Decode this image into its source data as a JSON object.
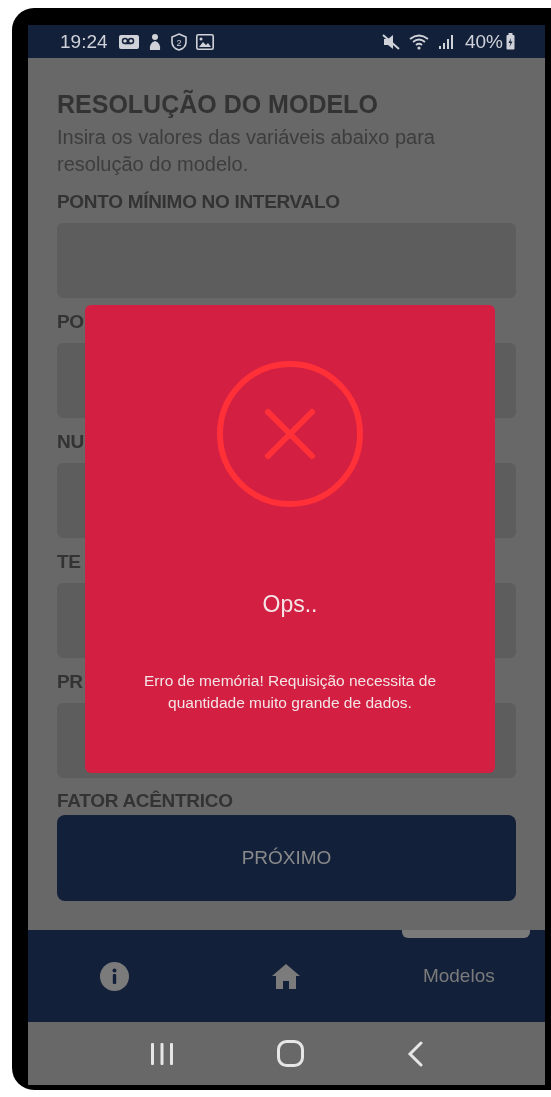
{
  "status_bar": {
    "time": "19:24",
    "shield_number": "2",
    "battery": "40%"
  },
  "page": {
    "title": "RESOLUÇÃO DO MODELO",
    "subtitle": "Insira os valores das variáveis abaixo para resolução do modelo.",
    "fields": [
      {
        "label": "PONTO MÍNIMO NO INTERVALO",
        "kind": "input"
      },
      {
        "label": "PO",
        "kind": "input"
      },
      {
        "label": "NU",
        "kind": "input"
      },
      {
        "label": "TE",
        "kind": "input"
      },
      {
        "label": "PR",
        "kind": "input"
      },
      {
        "label": "FATOR ACÊNTRICO",
        "kind": "heading"
      }
    ],
    "next_button": "PRÓXIMO"
  },
  "bottom_nav": [
    {
      "kind": "info"
    },
    {
      "kind": "home"
    },
    {
      "kind": "text",
      "label": "Modelos"
    }
  ],
  "dialog": {
    "title": "Ops..",
    "message": "Erro de memória! Requisição necessita de quantidade muito grande de dados."
  }
}
